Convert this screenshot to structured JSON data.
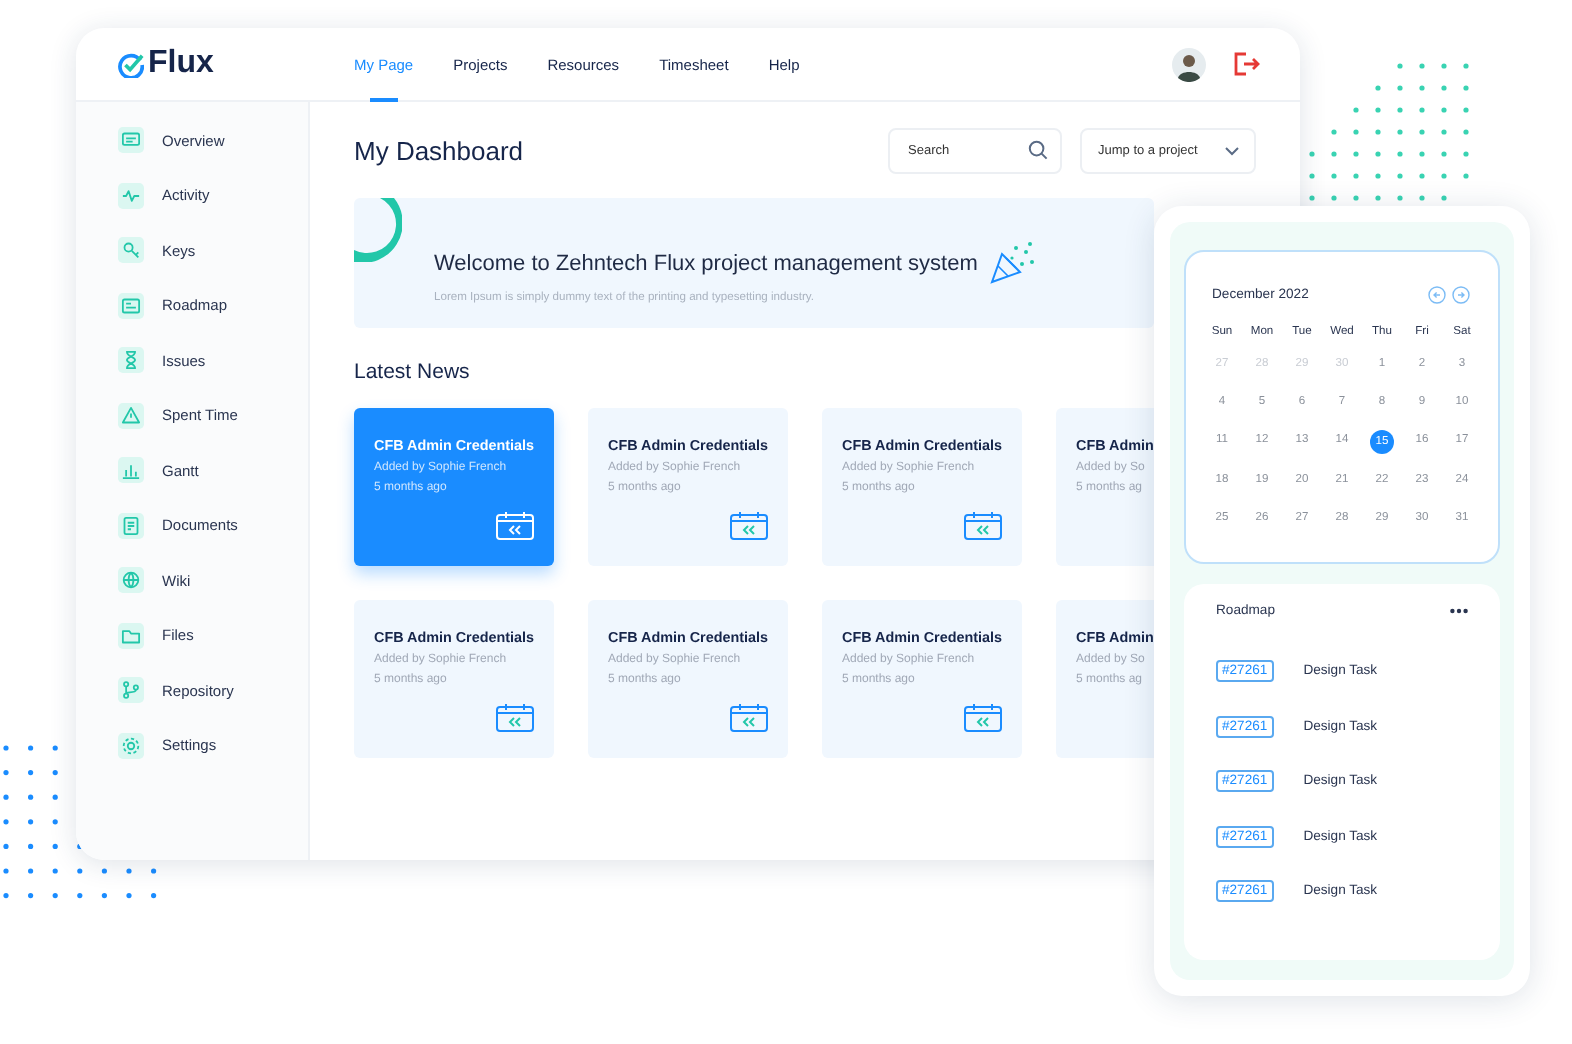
{
  "header": {
    "logo": "Flux",
    "nav": [
      {
        "label": "My Page",
        "selected": true
      },
      {
        "label": "Projects",
        "selected": false
      },
      {
        "label": "Resources",
        "selected": false
      },
      {
        "label": "Timesheet",
        "selected": false
      },
      {
        "label": "Help",
        "selected": false
      }
    ]
  },
  "sidebar": {
    "items": [
      {
        "label": "Overview"
      },
      {
        "label": "Activity"
      },
      {
        "label": "Keys"
      },
      {
        "label": "Roadmap"
      },
      {
        "label": "Issues"
      },
      {
        "label": "Spent Time"
      },
      {
        "label": "Gantt"
      },
      {
        "label": "Documents"
      },
      {
        "label": "Wiki"
      },
      {
        "label": "Files"
      },
      {
        "label": "Repository"
      },
      {
        "label": "Settings"
      }
    ]
  },
  "dashboard": {
    "title": "My Dashboard",
    "search": {
      "placeholder": "Search"
    },
    "project_select": {
      "label": "Jump to a project"
    }
  },
  "banner": {
    "title": "Welcome to Zehntech Flux project management system",
    "subtitle": "Lorem Ipsum is simply dummy text of the printing and typesetting industry."
  },
  "news": {
    "title": "Latest News",
    "cards": [
      {
        "kind": "full",
        "title": "CFB Admin Credentials",
        "author": "Added by Sophie French",
        "age": "5 months ago",
        "selected": true
      },
      {
        "kind": "full",
        "title": "CFB Admin Credentials",
        "author": "Added by Sophie French",
        "age": "5 months ago",
        "selected": false
      },
      {
        "kind": "full",
        "title": "CFB Admin Credentials",
        "author": "Added by Sophie French",
        "age": "5 months ago",
        "selected": false
      },
      {
        "kind": "partial",
        "title": "CFB Admin",
        "author": "Added by So",
        "age": "5 months ag",
        "selected": false
      },
      {
        "kind": "full",
        "title": "CFB Admin Credentials",
        "author": "Added by Sophie French",
        "age": "5 months ago",
        "selected": false
      },
      {
        "kind": "full",
        "title": "CFB Admin Credentials",
        "author": "Added by Sophie French",
        "age": "5 months ago",
        "selected": false
      },
      {
        "kind": "full",
        "title": "CFB Admin Credentials",
        "author": "Added by Sophie French",
        "age": "5 months ago",
        "selected": false
      },
      {
        "kind": "partial",
        "title": "CFB Admin",
        "author": "Added by So",
        "age": "5 months ag",
        "selected": false
      }
    ]
  },
  "calendar": {
    "month": "December 2022",
    "weekdays": [
      "Sun",
      "Mon",
      "Tue",
      "Wed",
      "Thu",
      "Fri",
      "Sat"
    ],
    "weeks": [
      [
        {
          "day": "27",
          "muted": true,
          "selected": false
        },
        {
          "day": "28",
          "muted": true,
          "selected": false
        },
        {
          "day": "29",
          "muted": true,
          "selected": false
        },
        {
          "day": "30",
          "muted": true,
          "selected": false
        },
        {
          "day": "1",
          "muted": false,
          "selected": false
        },
        {
          "day": "2",
          "muted": false,
          "selected": false
        },
        {
          "day": "3",
          "muted": false,
          "selected": false
        }
      ],
      [
        {
          "day": "4",
          "muted": false,
          "selected": false
        },
        {
          "day": "5",
          "muted": false,
          "selected": false
        },
        {
          "day": "6",
          "muted": false,
          "selected": false
        },
        {
          "day": "7",
          "muted": false,
          "selected": false
        },
        {
          "day": "8",
          "muted": false,
          "selected": false
        },
        {
          "day": "9",
          "muted": false,
          "selected": false
        },
        {
          "day": "10",
          "muted": false,
          "selected": false
        }
      ],
      [
        {
          "day": "11",
          "muted": false,
          "selected": false
        },
        {
          "day": "12",
          "muted": false,
          "selected": false
        },
        {
          "day": "13",
          "muted": false,
          "selected": false
        },
        {
          "day": "14",
          "muted": false,
          "selected": false
        },
        {
          "day": "15",
          "muted": false,
          "selected": true
        },
        {
          "day": "16",
          "muted": false,
          "selected": false
        },
        {
          "day": "17",
          "muted": false,
          "selected": false
        }
      ],
      [
        {
          "day": "18",
          "muted": false,
          "selected": false
        },
        {
          "day": "19",
          "muted": false,
          "selected": false
        },
        {
          "day": "20",
          "muted": false,
          "selected": false
        },
        {
          "day": "21",
          "muted": false,
          "selected": false
        },
        {
          "day": "22",
          "muted": false,
          "selected": false
        },
        {
          "day": "23",
          "muted": false,
          "selected": false
        },
        {
          "day": "24",
          "muted": false,
          "selected": false
        }
      ],
      [
        {
          "day": "25",
          "muted": false,
          "selected": false
        },
        {
          "day": "26",
          "muted": false,
          "selected": false
        },
        {
          "day": "27",
          "muted": false,
          "selected": false
        },
        {
          "day": "28",
          "muted": false,
          "selected": false
        },
        {
          "day": "29",
          "muted": false,
          "selected": false
        },
        {
          "day": "30",
          "muted": false,
          "selected": false
        },
        {
          "day": "31",
          "muted": false,
          "selected": false
        }
      ]
    ]
  },
  "roadmap": {
    "title": "Roadmap",
    "items": [
      {
        "tag": "#27261",
        "name": "Design Task"
      },
      {
        "tag": "#27261",
        "name": "Design Task"
      },
      {
        "tag": "#27261",
        "name": "Design Task"
      },
      {
        "tag": "#27261",
        "name": "Design Task"
      },
      {
        "tag": "#27261",
        "name": "Design Task"
      }
    ]
  }
}
